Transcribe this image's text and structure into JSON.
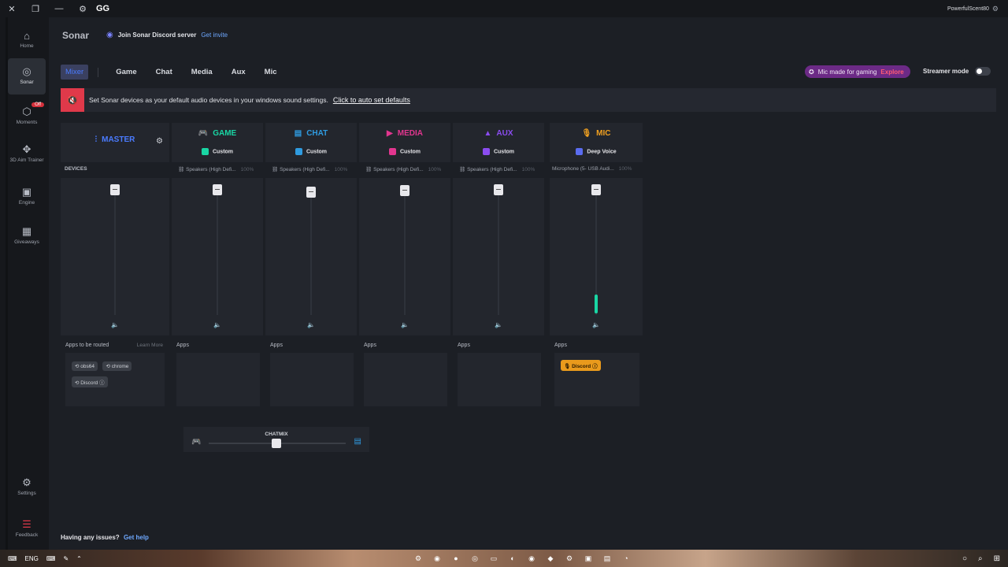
{
  "titlebar": {
    "app": "GG",
    "user": "PowerfulScent80"
  },
  "sidebar": {
    "items": [
      {
        "label": "Home"
      },
      {
        "label": "Sonar"
      },
      {
        "label": "Moments",
        "badge": "Off"
      },
      {
        "label": "3D Aim Trainer"
      },
      {
        "label": "Engine"
      },
      {
        "label": "Giveaways"
      },
      {
        "label": "Settings"
      },
      {
        "label": "Feedback"
      }
    ]
  },
  "header": {
    "title": "Sonar",
    "discord_label": "Join Sonar Discord server",
    "discord_link": "Get invite"
  },
  "tabs": [
    "Mixer",
    "Game",
    "Chat",
    "Media",
    "Aux",
    "Mic"
  ],
  "promo": {
    "text": "Mic made for gaming",
    "link": "Explore"
  },
  "streamer_mode": "Streamer mode",
  "banner": {
    "text": "Set Sonar devices as your default audio devices in your windows sound settings.",
    "link": "Click to auto set defaults"
  },
  "master": {
    "name": "MASTER",
    "devices_label": "DEVICES",
    "apps_label": "Apps to be routed",
    "learn_more": "Learn More",
    "apps": [
      "obs64",
      "chrome",
      "Discord"
    ]
  },
  "channels": [
    {
      "name": "GAME",
      "preset": "Custom",
      "device": "Speakers (High Defi...",
      "pct": "100%",
      "color": "#19d6a4",
      "apps_label": "Apps",
      "apps": []
    },
    {
      "name": "CHAT",
      "preset": "Custom",
      "device": "Speakers (High Defi...",
      "pct": "100%",
      "color": "#2f9be0",
      "apps_label": "Apps",
      "apps": []
    },
    {
      "name": "MEDIA",
      "preset": "Custom",
      "device": "Speakers (High Defi...",
      "pct": "100%",
      "color": "#e2368f",
      "apps_label": "Apps",
      "apps": []
    },
    {
      "name": "AUX",
      "preset": "Custom",
      "device": "Speakers (High Defi...",
      "pct": "100%",
      "color": "#8b4cf0",
      "apps_label": "Apps",
      "apps": []
    },
    {
      "name": "MIC",
      "preset": "Deep Voice",
      "device": "Microphone (5- USB Audi...",
      "pct": "100%",
      "color": "#f0a020",
      "apps_label": "Apps",
      "apps": [
        "Discord"
      ]
    }
  ],
  "chatmix": {
    "label": "CHATMIX"
  },
  "help": {
    "text": "Having any issues?",
    "link": "Get help"
  },
  "taskbar": {
    "lang": "ENG"
  }
}
